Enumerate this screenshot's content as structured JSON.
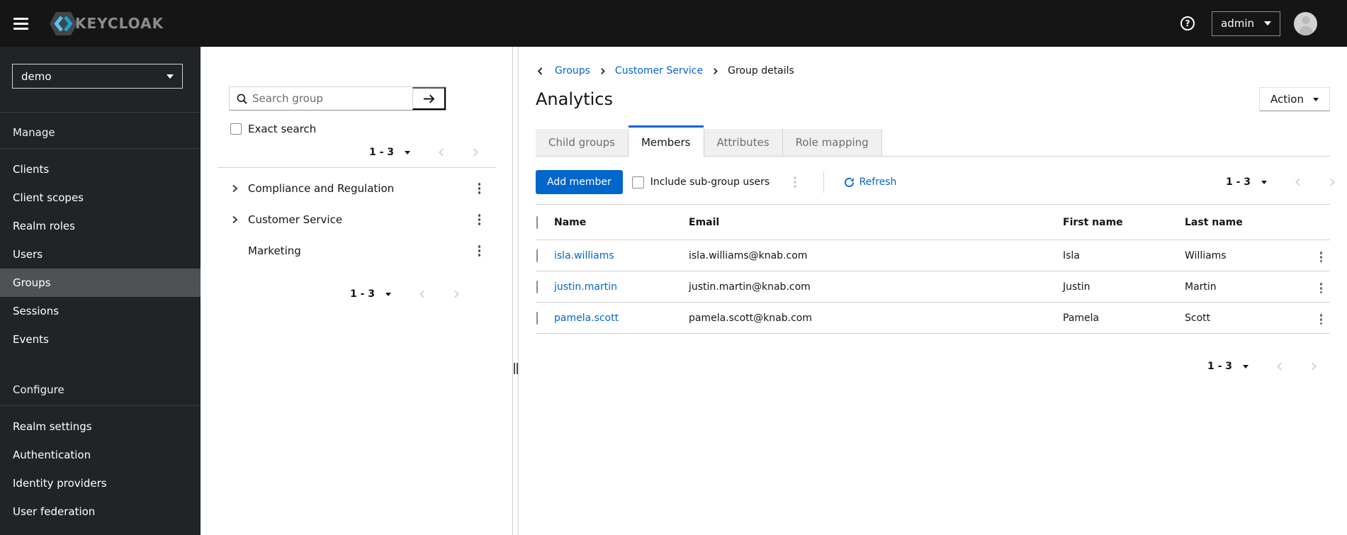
{
  "masthead": {
    "brand_text": "KEYCLOAK",
    "username": "admin"
  },
  "sidebar": {
    "realm": "demo",
    "manage": {
      "label": "Manage",
      "items": [
        "Clients",
        "Client scopes",
        "Realm roles",
        "Users",
        "Groups",
        "Sessions",
        "Events"
      ]
    },
    "configure": {
      "label": "Configure",
      "items": [
        "Realm settings",
        "Authentication",
        "Identity providers",
        "User federation"
      ]
    },
    "active_item": "Groups"
  },
  "group_tree": {
    "search_placeholder": "Search group",
    "exact_search_label": "Exact search",
    "pagination_top": {
      "range": "1 - 3"
    },
    "items": [
      {
        "name": "Compliance and Regulation",
        "expandable": true
      },
      {
        "name": "Customer Service",
        "expandable": true
      },
      {
        "name": "Marketing",
        "expandable": false
      }
    ],
    "pagination_bottom": {
      "range": "1 - 3"
    }
  },
  "main": {
    "breadcrumb": {
      "links": [
        "Groups",
        "Customer Service"
      ],
      "current": "Group details"
    },
    "page_title": "Analytics",
    "action_button_label": "Action",
    "tabs": {
      "labels": [
        "Child groups",
        "Members",
        "Attributes",
        "Role mapping"
      ],
      "active": "Members"
    },
    "toolbar": {
      "add_member_label": "Add member",
      "include_subgroups_label": "Include sub-group users",
      "refresh_label": "Refresh",
      "pagination": {
        "range": "1 - 3"
      }
    },
    "members_table": {
      "headers": {
        "name": "Name",
        "email": "Email",
        "first_name": "First name",
        "last_name": "Last name"
      },
      "rows": [
        {
          "name": "isla.williams",
          "email": "isla.williams@knab.com",
          "first_name": "Isla",
          "last_name": "Williams"
        },
        {
          "name": "justin.martin",
          "email": "justin.martin@knab.com",
          "first_name": "Justin",
          "last_name": "Martin"
        },
        {
          "name": "pamela.scott",
          "email": "pamela.scott@knab.com",
          "first_name": "Pamela",
          "last_name": "Scott"
        }
      ],
      "pagination": {
        "range": "1 - 3"
      }
    }
  },
  "colors": {
    "accent_blue": "#0066cc",
    "masthead_bg": "#151515",
    "sidebar_bg": "#212427",
    "sidebar_active_bg": "#4f5255",
    "border_gray": "#d2d2d2",
    "muted_text": "#6a6e73",
    "text": "#151515",
    "logo_cyan_light": "#5bc2e7",
    "logo_cyan_dark": "#1fa0d0",
    "inactive_tab_bg": "#f0f0f0"
  }
}
